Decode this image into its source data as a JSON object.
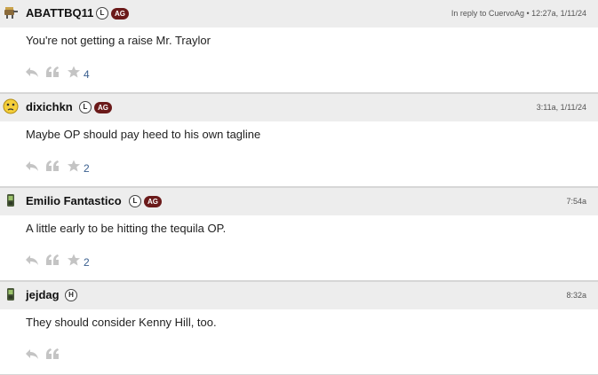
{
  "posts": [
    {
      "username": "ABATTBQ11",
      "badges": [
        "L",
        "AG"
      ],
      "meta": "In reply to CuervoAg • 12:27a, 1/11/24",
      "text": "You're not getting a raise Mr. Traylor",
      "star_count": "4",
      "avatar_icon": "grill-icon"
    },
    {
      "username": "dixichkn",
      "badges": [
        "L",
        "AG"
      ],
      "meta": "3:11a, 1/11/24",
      "text": "Maybe OP should pay heed to his own tagline",
      "star_count": "2",
      "avatar_icon": "confused-face-icon"
    },
    {
      "username": "Emilio Fantastico",
      "badges": [
        "L",
        "AG"
      ],
      "meta": "7:54a",
      "text": "A little early to be hitting the tequila OP.",
      "star_count": "2",
      "avatar_icon": "phone-icon"
    },
    {
      "username": "jejdag",
      "badges": [
        "H"
      ],
      "meta": "8:32a",
      "text": "They should consider Kenny Hill, too.",
      "star_count": "",
      "avatar_icon": "phone-icon"
    }
  ],
  "colors": {
    "header_bg": "#ededed",
    "ag_badge": "#6b1a1a",
    "count_link": "#3a5f8f",
    "action_icon": "#c4c4c4"
  }
}
